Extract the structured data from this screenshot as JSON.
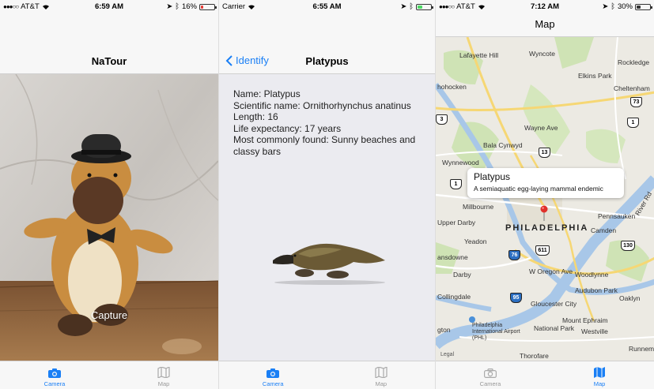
{
  "screen1": {
    "status": {
      "carrier": "AT&T",
      "time": "6:59 AM",
      "battery_text": "16%",
      "battery_level": 0.16,
      "battery_color": "#e53935"
    },
    "nav_title": "NaTour",
    "capture_label": "Capture",
    "tabs": [
      {
        "label": "Camera",
        "icon": "camera-icon",
        "active": true
      },
      {
        "label": "Map",
        "icon": "map-icon",
        "active": false
      }
    ]
  },
  "screen2": {
    "status": {
      "carrier": "Carrier",
      "time": "6:55 AM",
      "battery_level": 0.4,
      "battery_color": "#4cd964"
    },
    "back_label": "Identify",
    "nav_title": "Platypus",
    "details": [
      "Name: Platypus",
      "Scientific name: Ornithorhynchus anatinus",
      "Length: 16",
      "Life expectancy: 17 years",
      "Most commonly found: Sunny beaches and classy bars"
    ],
    "tabs": [
      {
        "label": "Camera",
        "icon": "camera-icon",
        "active": true
      },
      {
        "label": "Map",
        "icon": "map-icon",
        "active": false
      }
    ]
  },
  "screen3": {
    "status": {
      "carrier": "AT&T",
      "time": "7:12 AM",
      "battery_text": "30%",
      "battery_level": 0.3,
      "battery_color": "#333333"
    },
    "nav_title": "Map",
    "callout": {
      "title": "Platypus",
      "subtitle": "A semiaquatic egg-laying mammal endemic"
    },
    "map_labels": {
      "lafayette_hill": "Lafayette Hill",
      "wyncote": "Wyncote",
      "rockledge": "Rockledge",
      "elkins_park": "Elkins Park",
      "hohocken": "hohocken",
      "cheltenham": "Cheltenham",
      "wayne_ave": "Wayne Ave",
      "bala_cynwyd": "Bala Cynwyd",
      "wynnewood": "Wynnewood",
      "millbourne": "Millbourne",
      "upper_darby": "Upper Darby",
      "yeadon": "Yeadon",
      "philadelphia": "PHILADELPHIA",
      "camden": "Camden",
      "pennsauken": "Pennsauken",
      "lansdowne": "ansdowne",
      "darby": "Darby",
      "w_oregon_ave": "W Oregon Ave",
      "woodlynne": "Woodlynne",
      "collingdale": "Collingdale",
      "audubon_park": "Audubon Park",
      "oaklyn": "Oaklyn",
      "glenolden": "olenolden",
      "gloucester_city": "Gloucester City",
      "airport": "Philadelphia International Airport (PHL)",
      "tinicum": "gton",
      "national_park": "National Park",
      "mount_ephraim": "Mount Ephraim",
      "westville": "Westville",
      "thorofare": "Thorofare",
      "runnemede": "Runnem",
      "river_rd": "River Rd"
    },
    "shields": {
      "r73": "73",
      "r1a": "1",
      "r1b": "1",
      "r13": "13",
      "r611": "611",
      "r76": "76",
      "r95": "95",
      "r130": "130",
      "r3": "3"
    },
    "legal": "Legal",
    "tabs": [
      {
        "label": "Camera",
        "icon": "camera-icon",
        "active": false
      },
      {
        "label": "Map",
        "icon": "map-icon",
        "active": true
      }
    ]
  },
  "colors": {
    "accent": "#1a7ff5",
    "inactive": "#999999",
    "pin": "#e0302a"
  }
}
